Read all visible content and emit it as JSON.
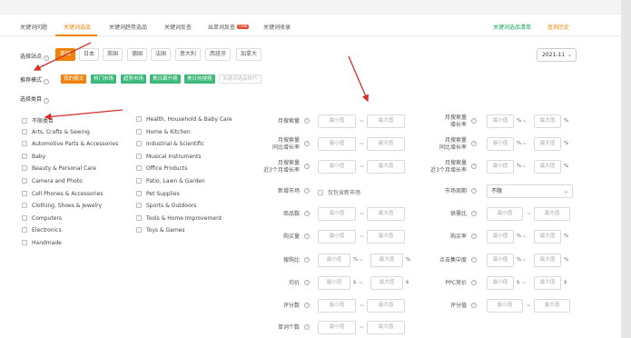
{
  "tabs": [
    {
      "label": "关键词问题"
    },
    {
      "label": "关键词选品"
    },
    {
      "label": "关键词趋势选品"
    },
    {
      "label": "关键词反查"
    },
    {
      "label": "出单词反查"
    },
    {
      "label": "关键词收录"
    }
  ],
  "tab_badge": "new",
  "tabs_right": [
    {
      "label": "关键词选品清单"
    },
    {
      "label": "查询历史"
    }
  ],
  "site_row": {
    "label": "选择站点",
    "sites": [
      "美国",
      "日本",
      "英国",
      "德国",
      "法国",
      "意大利",
      "西班牙",
      "加拿大"
    ],
    "date": "2021-11"
  },
  "mode_row": {
    "label": "推荐模式",
    "modes": [
      "我的模式",
      "热门市场",
      "趋势市场",
      "美日飙升榜",
      "美日热搜榜",
      "关键词选品技巧"
    ]
  },
  "category_label": "选择类目",
  "categories_col1": [
    "不限类目",
    "Arts, Crafts & Sewing",
    "Automotive Parts & Accessories",
    "Baby",
    "Beauty & Personal Care",
    "Camera and Photo",
    "Cell Phones & Accessories",
    "Clothing, Shoes & Jewelry",
    "Computers",
    "Electronics",
    "Handmade"
  ],
  "categories_col2": [
    "Health, Household & Baby Care",
    "Home & Kitchen",
    "Industrial & Scientific",
    "Musical Instruments",
    "Office Products",
    "Patio, Lawn & Garden",
    "Pet Supplies",
    "Sports & Outdoors",
    "Tools & Home Improvement",
    "Toys & Games"
  ],
  "placeholders": {
    "min": "最小值",
    "max": "最大值"
  },
  "filters_left": [
    {
      "label": "月搜索量"
    },
    {
      "label": "月搜索量",
      "label2": "同比增长率"
    },
    {
      "label": "月搜索量",
      "label2": "近3个月增长率"
    },
    {
      "label": "新增市场",
      "checkbox": "仅包含新市场"
    },
    {
      "label": "商品数"
    },
    {
      "label": "购买量"
    },
    {
      "label": "搜购比",
      "unit": "%"
    },
    {
      "label": "均价",
      "unit": "$"
    },
    {
      "label": "评分数"
    },
    {
      "label": "单词个数"
    }
  ],
  "filters_right": [
    {
      "label": "月搜索量",
      "label2": "增长率",
      "unit": "%"
    },
    {
      "label": "月搜索量",
      "label2": "同比增长率",
      "unit": "%"
    },
    {
      "label": "月搜索量",
      "label2": "近3个月增长率",
      "unit": "%"
    },
    {
      "label": "市场周期",
      "select": "不限"
    },
    {
      "label": "供需比"
    },
    {
      "label": "购买率",
      "unit": "%"
    },
    {
      "label": "点击集中度",
      "unit": "%"
    },
    {
      "label": "PPC竞价",
      "unit": "$"
    },
    {
      "label": "评分值"
    }
  ],
  "colors": {
    "accent": "#f0820a",
    "green": "#3cb878",
    "arrow": "#d9302c"
  }
}
